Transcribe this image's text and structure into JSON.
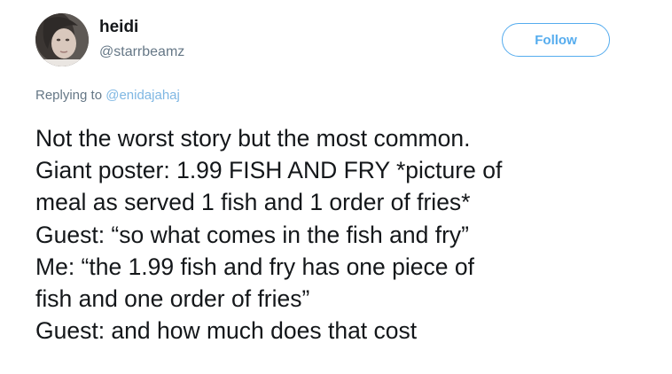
{
  "author": {
    "display_name": "heidi",
    "handle": "@starrbeamz"
  },
  "follow_button": {
    "label": "Follow"
  },
  "reply": {
    "prefix": "Replying to",
    "mention": "@enidajahaj"
  },
  "tweet": {
    "lines": [
      "Not the worst story but the most common.",
      "Giant poster: 1.99 FISH AND FRY *picture of",
      "meal as served 1 fish and 1 order of fries*",
      "Guest: “so what comes in the fish and fry”",
      "Me: “the 1.99 fish and fry has one piece of",
      "fish and one order of fries”",
      "Guest: and how much does that cost"
    ]
  },
  "colors": {
    "accent": "#55acee",
    "text": "#14171a",
    "muted": "#657786"
  }
}
